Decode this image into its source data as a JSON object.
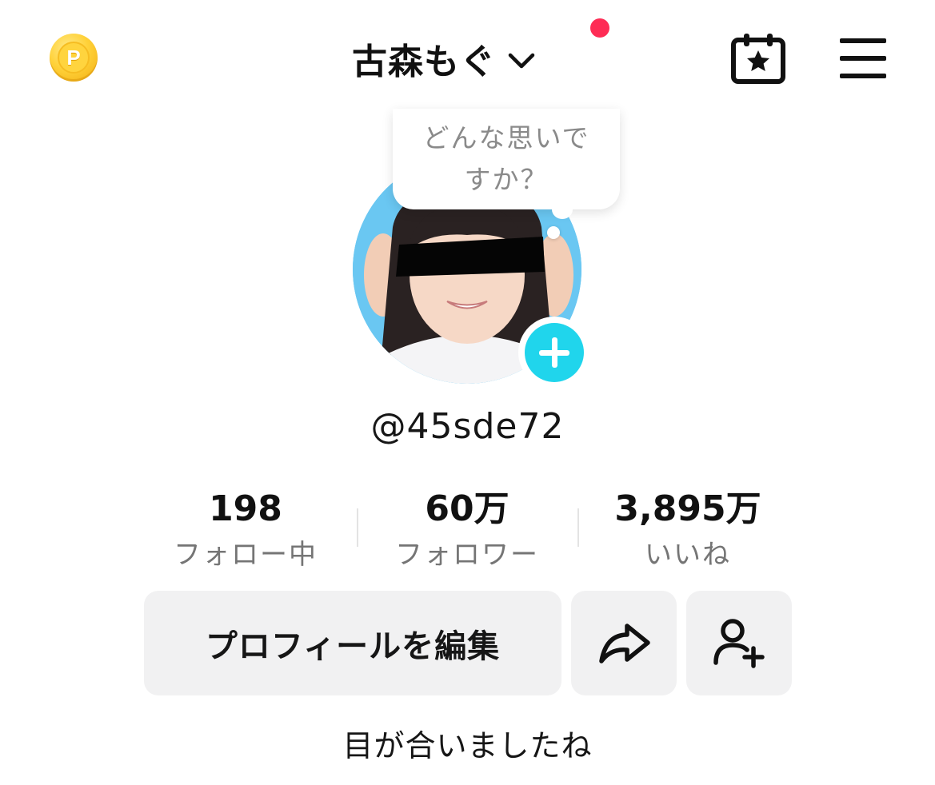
{
  "header": {
    "coin_letter": "P",
    "title": "古森もぐ",
    "chevron_icon": "chevron-down-icon",
    "calendar_icon": "calendar-star-icon",
    "menu_icon": "hamburger-menu-icon",
    "notification_color": "#fe2c55"
  },
  "avatar": {
    "thought_bubble": "どんな思いですか？",
    "add_icon": "plus-icon",
    "add_color": "#20d5ec"
  },
  "profile": {
    "username": "@45sde72",
    "bio": "目が合いましたね"
  },
  "stats": [
    {
      "value": "198",
      "label": "フォロー中"
    },
    {
      "value": "60万",
      "label": "フォロワー"
    },
    {
      "value": "3,895万",
      "label": "いいね"
    }
  ],
  "actions": {
    "edit_profile": "プロフィールを編集",
    "share_icon": "share-arrow-icon",
    "add_friend_icon": "add-friend-icon"
  }
}
